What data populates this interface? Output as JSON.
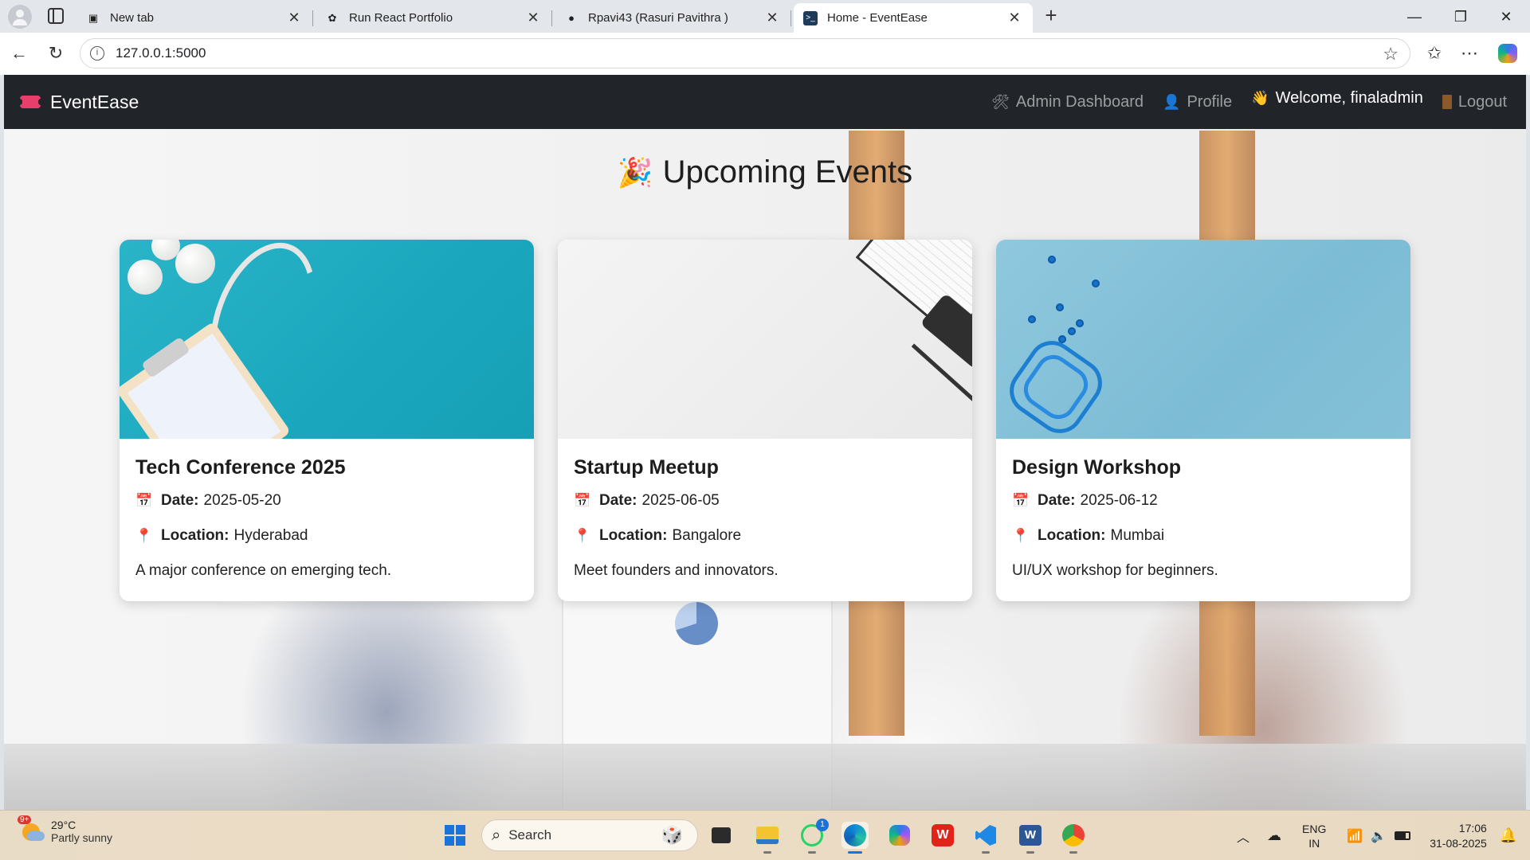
{
  "browser": {
    "tabs": [
      {
        "title": "New tab",
        "icon": "new-tab-icon"
      },
      {
        "title": "Run React Portfolio",
        "icon": "openai-icon"
      },
      {
        "title": "Rpavi43 (Rasuri Pavithra )",
        "icon": "github-icon"
      },
      {
        "title": "Home - EventEase",
        "icon": "terminal-icon",
        "active": true
      }
    ],
    "address": "127.0.0.1:5000"
  },
  "navbar": {
    "brand": "EventEase",
    "admin_dashboard": "Admin Dashboard",
    "profile": "Profile",
    "welcome": "Welcome, finaladmin",
    "logout": "Logout"
  },
  "page": {
    "heading": "Upcoming Events"
  },
  "labels": {
    "date": "Date:",
    "location": "Location:"
  },
  "events": [
    {
      "title": "Tech Conference 2025",
      "date": "2025-05-20",
      "location": "Hyderabad",
      "description": "A major conference on emerging tech."
    },
    {
      "title": "Startup Meetup",
      "date": "2025-06-05",
      "location": "Bangalore",
      "description": "Meet founders and innovators."
    },
    {
      "title": "Design Workshop",
      "date": "2025-06-12",
      "location": "Mumbai",
      "description": "UI/UX workshop for beginners."
    }
  ],
  "taskbar": {
    "weather_badge": "9+",
    "temperature": "29°C",
    "condition": "Partly sunny",
    "search_placeholder": "Search",
    "whatsapp_badge": "1",
    "language": "ENG",
    "region": "IN",
    "time": "17:06",
    "date": "31-08-2025"
  },
  "colors": {
    "navbar_bg": "#212529",
    "accent_blue": "#1a73d9"
  }
}
